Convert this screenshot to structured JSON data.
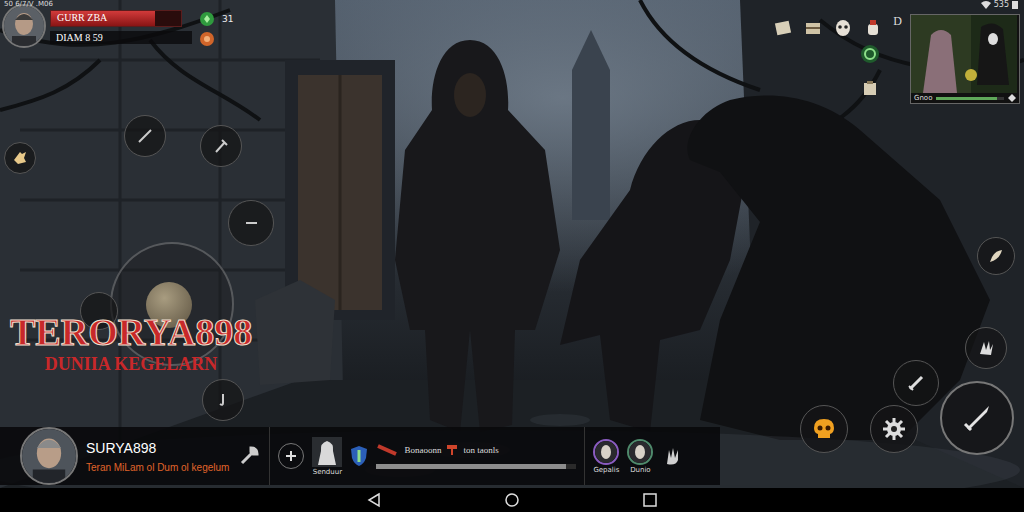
{
  "status_bar": {
    "left": "50 6/7/V .M06",
    "right": "535"
  },
  "player": {
    "name": "GURR ZBA",
    "gems": "31",
    "stat": "DIAM 8 59",
    "health": 0.8
  },
  "logo": {
    "title": "TERORYA898",
    "subtitle": "DUNIIA KEGELARN"
  },
  "marker": "D",
  "minimap": {
    "caption": "Gnoo",
    "level": 0.9
  },
  "profile": {
    "name": "SURYA898",
    "subtitle": "Teran MiLam ol Dum ol kegelum"
  },
  "card": {
    "label": "Senduur"
  },
  "quest": {
    "title": "Bonaoonn",
    "tag": "ton taonls",
    "level": 0.95
  },
  "companions": [
    {
      "label": "Gepalis",
      "color": "#8a5cc0"
    },
    {
      "label": "Dunio",
      "color": "#4f8a6c"
    }
  ]
}
